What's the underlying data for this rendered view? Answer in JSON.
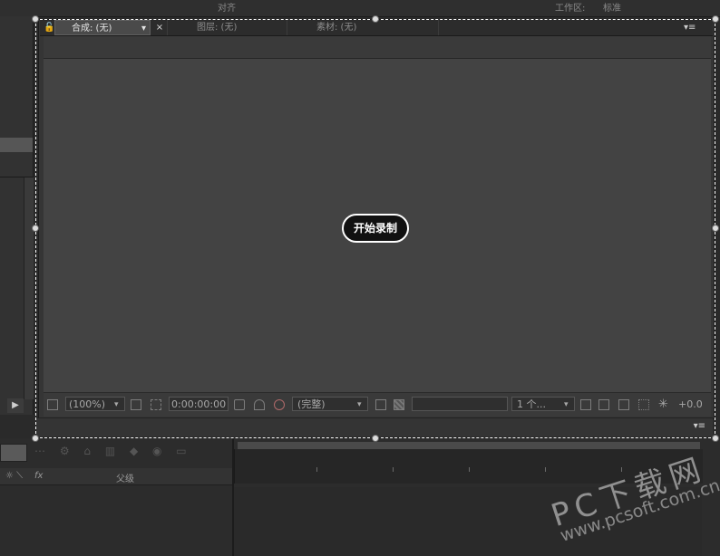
{
  "top": {
    "align_label": "对齐",
    "workspace_label": "工作区:",
    "workspace_value": "标准"
  },
  "viewer": {
    "tabs": [
      {
        "label": "合成: (无)"
      },
      {
        "label": "图层: (无)"
      },
      {
        "label": "素材: (无)"
      }
    ],
    "close_glyph": "×",
    "menu_glyph": "▾≡",
    "record_button": "开始录制",
    "toolbar": {
      "zoom": "(100%)",
      "timecode": "0:00:00:00",
      "resolution": "(完整)",
      "views": "1 个...",
      "exposure": "+0.0"
    }
  },
  "timeline": {
    "parent_label": "父级",
    "fx_label": "fx"
  },
  "watermark": {
    "brand": "PC下载网",
    "url": "www.pcsoft.com.cn"
  },
  "colors": {
    "canvas": "#434343",
    "panel": "#3a3a3a",
    "selection": "#ffffff",
    "record_bg": "#111111"
  }
}
